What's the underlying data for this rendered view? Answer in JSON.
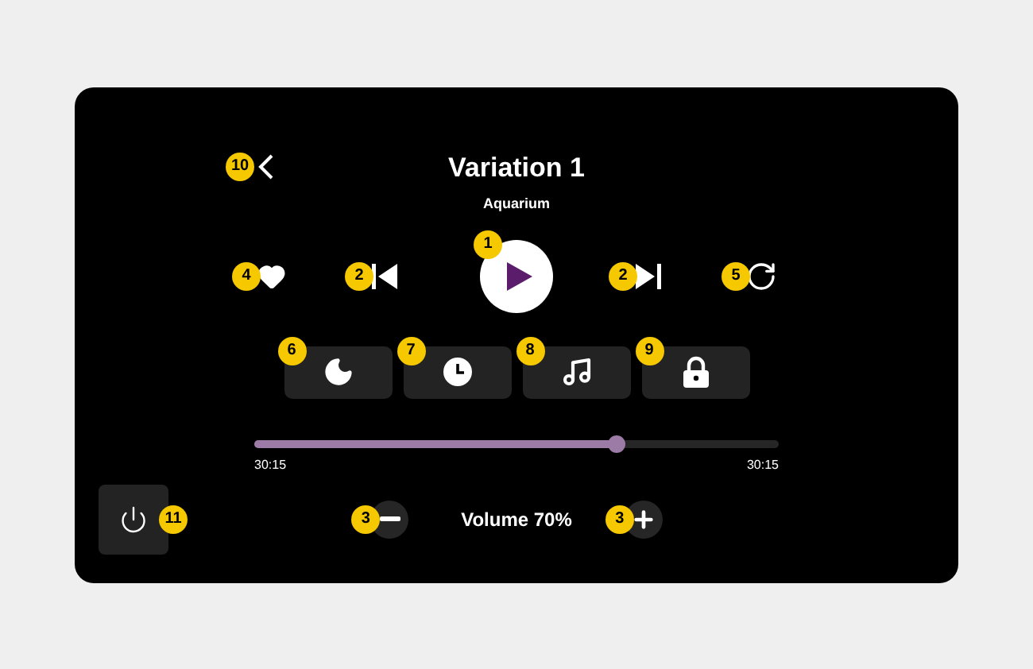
{
  "header": {
    "back_callout": "10",
    "title": "Variation 1",
    "subtitle": "Aquarium"
  },
  "transport": [
    {
      "kind": "favorite",
      "callout": "4"
    },
    {
      "kind": "previous",
      "callout": "2"
    },
    {
      "kind": "play",
      "callout": "1"
    },
    {
      "kind": "next",
      "callout": "2"
    },
    {
      "kind": "repeat",
      "callout": "5"
    }
  ],
  "quick_buttons": [
    {
      "kind": "sleep",
      "callout": "6"
    },
    {
      "kind": "timer",
      "callout": "7"
    },
    {
      "kind": "music",
      "callout": "8"
    },
    {
      "kind": "lock",
      "callout": "9"
    }
  ],
  "progress": {
    "level": 0.69,
    "elapsed": "30:15",
    "total": "30:15"
  },
  "power": {
    "callout": "11"
  },
  "volume": {
    "label": "Volume 70%",
    "down_callout": "3",
    "up_callout": "3"
  }
}
